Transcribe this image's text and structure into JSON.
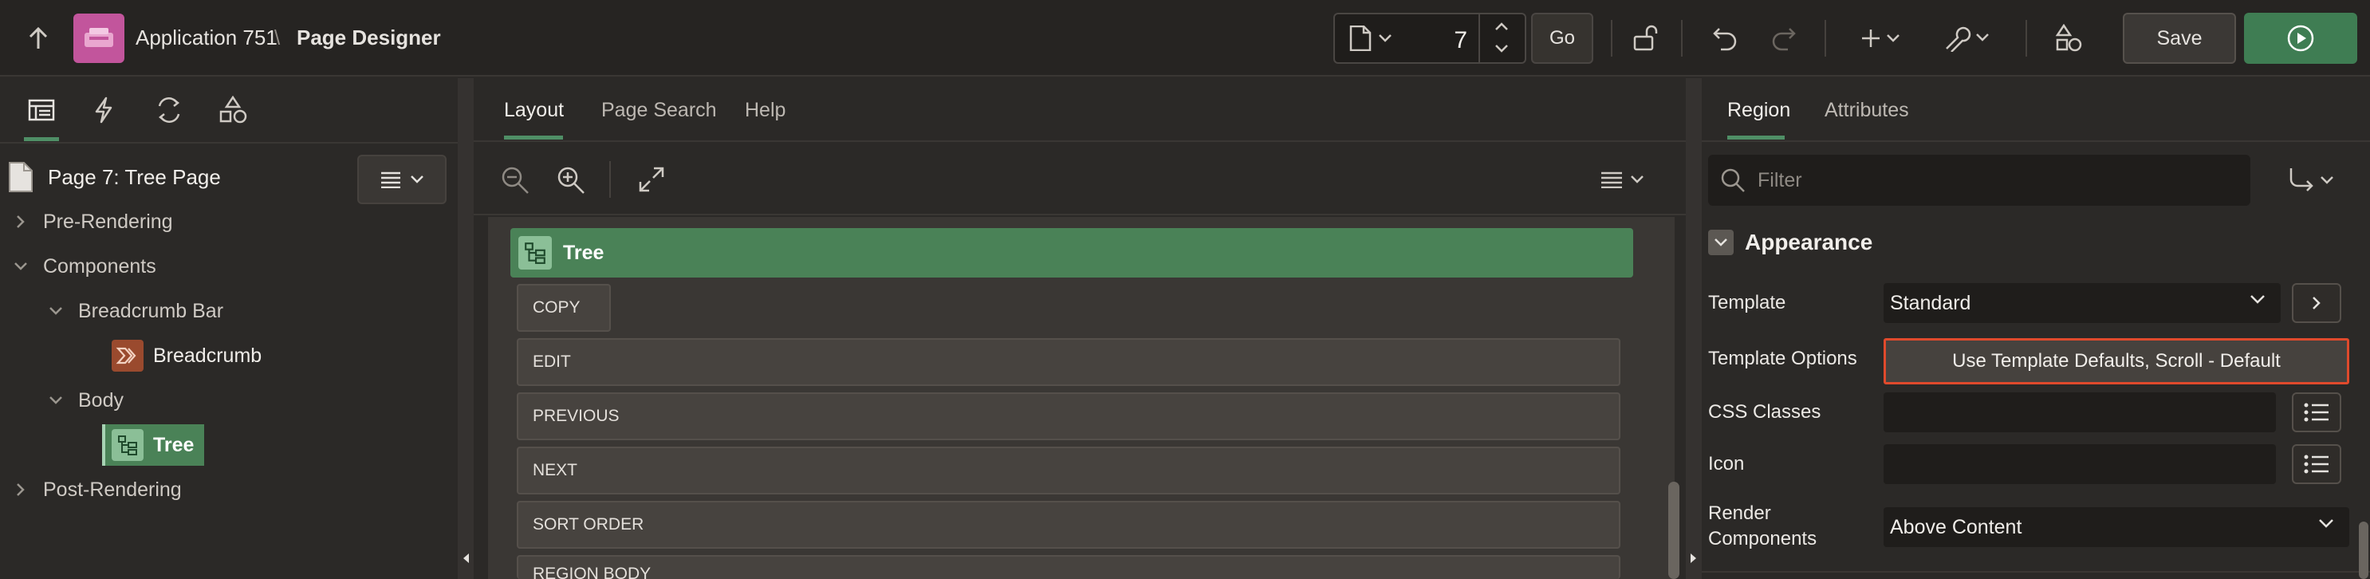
{
  "header": {
    "app_name": "Application 751",
    "divider": "\\",
    "page_title": "Page Designer",
    "page_number": "7",
    "go_label": "Go",
    "save_label": "Save"
  },
  "left_panel": {
    "page_label": "Page 7: Tree Page",
    "tree": [
      {
        "label": "Pre-Rendering"
      },
      {
        "label": "Components"
      },
      {
        "label": "Breadcrumb Bar"
      },
      {
        "label": "Breadcrumb"
      },
      {
        "label": "Body"
      },
      {
        "label": "Tree"
      },
      {
        "label": "Post-Rendering"
      }
    ]
  },
  "center": {
    "tabs": [
      {
        "label": "Layout"
      },
      {
        "label": "Page Search"
      },
      {
        "label": "Help"
      }
    ],
    "region_title": "Tree",
    "buttons": [
      {
        "label": "COPY"
      },
      {
        "label": "EDIT"
      },
      {
        "label": "PREVIOUS"
      },
      {
        "label": "NEXT"
      },
      {
        "label": "SORT ORDER"
      },
      {
        "label": "REGION BODY"
      }
    ]
  },
  "right_panel": {
    "tabs": [
      {
        "label": "Region"
      },
      {
        "label": "Attributes"
      }
    ],
    "filter_placeholder": "Filter",
    "section_title": "Appearance",
    "properties": {
      "template_label": "Template",
      "template_value": "Standard",
      "template_options_label": "Template Options",
      "template_options_value": "Use Template Defaults, Scroll - Default",
      "css_classes_label": "CSS Classes",
      "icon_label": "Icon",
      "render_components_label_1": "Render",
      "render_components_label_2": "Components",
      "render_components_value": "Above Content"
    }
  },
  "colors": {
    "accent_green": "#4a8257",
    "run_button": "#3f7d53",
    "app_icon": "#c2559c",
    "highlight_red": "#e04a2c",
    "breadcrumb_icon": "#9a4a2e"
  },
  "icons": [
    "up-arrow-icon",
    "application-icon",
    "page-icon",
    "spinner-up-icon",
    "spinner-down-icon",
    "lock-icon",
    "undo-icon",
    "redo-icon",
    "plus-icon",
    "wrench-icon",
    "shapes-icon",
    "run-icon",
    "rendering-icon",
    "lightning-icon",
    "processing-icon",
    "shared-components-icon",
    "chevron-right-icon",
    "chevron-down-icon",
    "menu-icon",
    "zoom-out-icon",
    "zoom-in-icon",
    "expand-icon",
    "tree-region-icon",
    "breadcrumb-icon",
    "search-icon",
    "goto-icon",
    "list-icon"
  ]
}
